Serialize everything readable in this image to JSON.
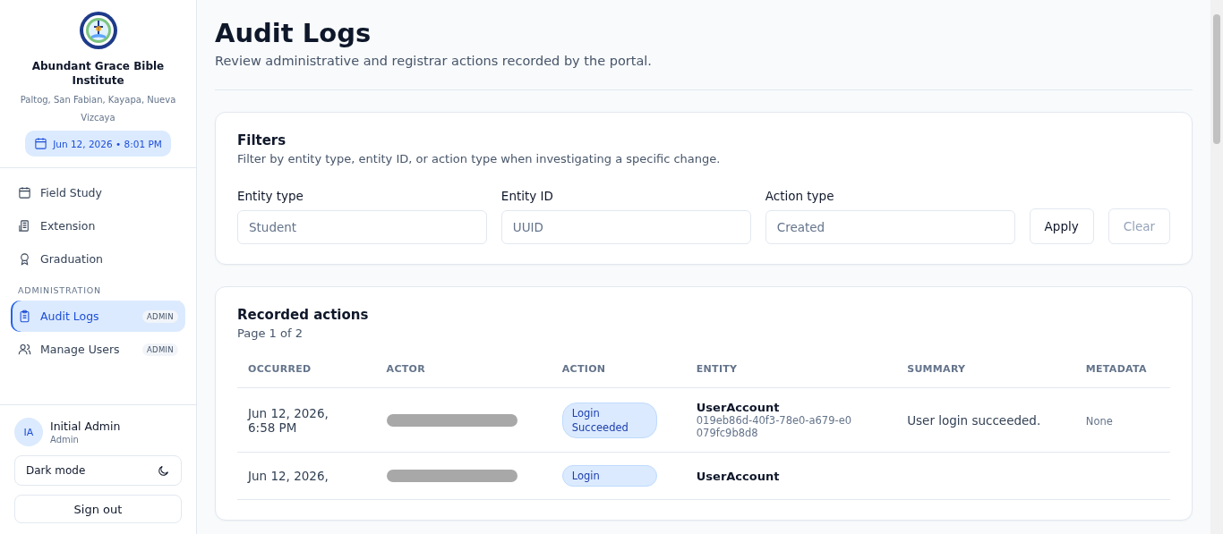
{
  "sidebar": {
    "school_name": "Abundant Grace Bible Institute",
    "address": "Paltog, San Fabian, Kayapa, Nueva Vizcaya",
    "datetime": "Jun 12, 2026 • 8:01 PM",
    "items": [
      {
        "label": "Field Study",
        "selected": false
      },
      {
        "label": "Extension",
        "selected": false
      },
      {
        "label": "Graduation",
        "selected": false
      }
    ],
    "section_title": "ADMINISTRATION",
    "admin_items": [
      {
        "label": "Audit Logs",
        "badge": "ADMIN",
        "selected": true
      },
      {
        "label": "Manage Users",
        "badge": "ADMIN",
        "selected": false
      }
    ],
    "user": {
      "initials": "IA",
      "name": "Initial Admin",
      "role": "Admin"
    },
    "dark_mode": "Dark mode",
    "sign_out": "Sign out"
  },
  "page": {
    "title": "Audit Logs",
    "subtitle": "Review administrative and registrar actions recorded by the portal."
  },
  "filters": {
    "title": "Filters",
    "description": "Filter by entity type, entity ID, or action type when investigating a specific change.",
    "fields": [
      {
        "label": "Entity type",
        "placeholder": "Student"
      },
      {
        "label": "Entity ID",
        "placeholder": "UUID"
      },
      {
        "label": "Action type",
        "placeholder": "Created"
      }
    ],
    "apply": "Apply",
    "clear": "Clear"
  },
  "table": {
    "title": "Recorded actions",
    "page_info": "Page 1 of 2",
    "columns": [
      "OCCURRED",
      "ACTOR",
      "ACTION",
      "ENTITY",
      "SUMMARY",
      "METADATA"
    ],
    "rows": [
      {
        "occurred": "Jun 12, 2026, 6:58 PM",
        "action": "Login Succeeded",
        "entity": "UserAccount",
        "entity_id": "019eb86d-40f3-78e0-a679-e0079fc9b8d8",
        "summary": "User login succeeded.",
        "metadata": "None"
      },
      {
        "occurred": "Jun 12, 2026,",
        "action": "Login",
        "entity": "UserAccount"
      }
    ]
  }
}
